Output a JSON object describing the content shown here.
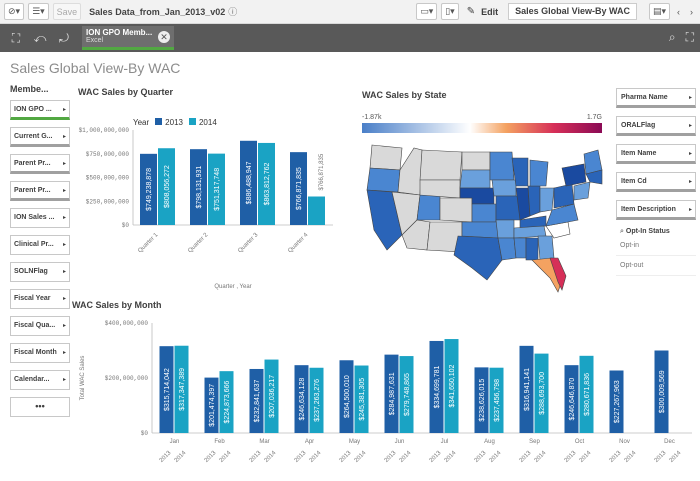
{
  "toolbar": {
    "save_label": "Save",
    "app_title": "Sales Data_from_Jan_2013_v02",
    "edit_label": "Edit",
    "sheet_name": "Sales Global View-By WAC"
  },
  "selection": {
    "chip_title": "ION GPO Memb...",
    "chip_subtitle": "Excel"
  },
  "sheet_title": "Sales Global View-By WAC",
  "left_panel": {
    "header": "Membe...",
    "filters": [
      {
        "label": "ION GPO ...",
        "style": "green"
      },
      {
        "label": "Current G...",
        "style": "gray"
      },
      {
        "label": "Parent Pr...",
        "style": "gray"
      },
      {
        "label": "Parent Pr...",
        "style": "gray"
      },
      {
        "label": "ION Sales ...",
        "style": "none"
      },
      {
        "label": "Clinical Pr...",
        "style": "none"
      },
      {
        "label": "SOLNFlag",
        "style": "none"
      },
      {
        "label": "Fiscal Year",
        "style": "none"
      },
      {
        "label": "Fiscal Qua...",
        "style": "none"
      },
      {
        "label": "Fiscal Month",
        "style": "none"
      },
      {
        "label": "Calendar...",
        "style": "none"
      }
    ],
    "more_label": "•••"
  },
  "right_panel": {
    "filters": [
      "Pharma Name",
      "ORALFlag",
      "Item Name",
      "Item Cd",
      "Item Description"
    ],
    "optin_header": "Opt-In Status",
    "optin_values": [
      "Opt-in",
      "Opt-out"
    ]
  },
  "quarter_chart": {
    "title": "WAC Sales by Quarter",
    "legend_title": "Year",
    "series_names": [
      "2013",
      "2014"
    ],
    "y_ticks": [
      "$1,000,000,000",
      "$750,000,000",
      "$500,000,000",
      "$250,000,000",
      "$0"
    ],
    "xlabel": "Quarter , Year"
  },
  "map": {
    "title": "WAC Sales by State",
    "legend_min": "-1.87k",
    "legend_max": "1.7G"
  },
  "month_chart": {
    "title": "WAC Sales by Month",
    "ylabel": "Total WAC Sales",
    "y_ticks": [
      "$400,000,000",
      "$200,000,000",
      "$0"
    ]
  },
  "colors": {
    "series_2013": "#1f5fa6",
    "series_2014": "#1aa3c4",
    "accent_green": "#52a842"
  },
  "chart_data": [
    {
      "type": "bar",
      "title": "WAC Sales by Quarter",
      "xlabel": "Quarter , Year",
      "ylabel": "",
      "categories": [
        "Quarter 1",
        "Quarter 2",
        "Quarter 3",
        "Quarter 4"
      ],
      "ylim": [
        0,
        1000000000
      ],
      "series": [
        {
          "name": "2013",
          "values": [
            749238878,
            798131931,
            886488947,
            766871835
          ],
          "labels": [
            "$749,238,878",
            "$798,131,931",
            "$886,488,947",
            "$766,871,835"
          ]
        },
        {
          "name": "2014",
          "values": [
            808056272,
            751317748,
            863812762,
            300000000
          ],
          "labels": [
            "$808,056,272",
            "$751,317,748",
            "$863,812,762",
            ""
          ]
        }
      ],
      "legend": "top-left"
    },
    {
      "type": "bar",
      "title": "WAC Sales by Month",
      "xlabel": "",
      "ylabel": "Total WAC Sales",
      "categories": [
        "Jan",
        "Feb",
        "Mar",
        "Apr",
        "May",
        "Jun",
        "Jul",
        "Aug",
        "Sep",
        "Oct",
        "Nov",
        "Dec"
      ],
      "sub_categories": [
        "2013",
        "2014"
      ],
      "ylim": [
        0,
        400000000
      ],
      "series": [
        {
          "name": "2013",
          "values": [
            315714042,
            201474397,
            232841637,
            246634128,
            264500010,
            284987631,
            334699781,
            238626015,
            316941141,
            246646870,
            227267963,
            300009569
          ],
          "labels": [
            "$315,714,042",
            "$201,474,397",
            "$232,841,637",
            "$246,634,128",
            "$264,500,010",
            "$284,987,631",
            "$334,699,781",
            "$238,626,015",
            "$316,941,141",
            "$246,646,870",
            "$227,267,963",
            "$300,009,569"
          ]
        },
        {
          "name": "2014",
          "values": [
            317347389,
            224873666,
            267036217,
            237263276,
            245381305,
            279748865,
            341650102,
            237456798,
            288693700,
            280671836,
            0,
            0
          ],
          "labels": [
            "$317,347,389",
            "$224,873,666",
            "$207,036,217",
            "$237,263,276",
            "$245,381,305",
            "$279,748,865",
            "$341,650,102",
            "$237,456,798",
            "$288,693,700",
            "$280,671,836",
            "",
            ""
          ]
        }
      ],
      "grid": false
    }
  ]
}
